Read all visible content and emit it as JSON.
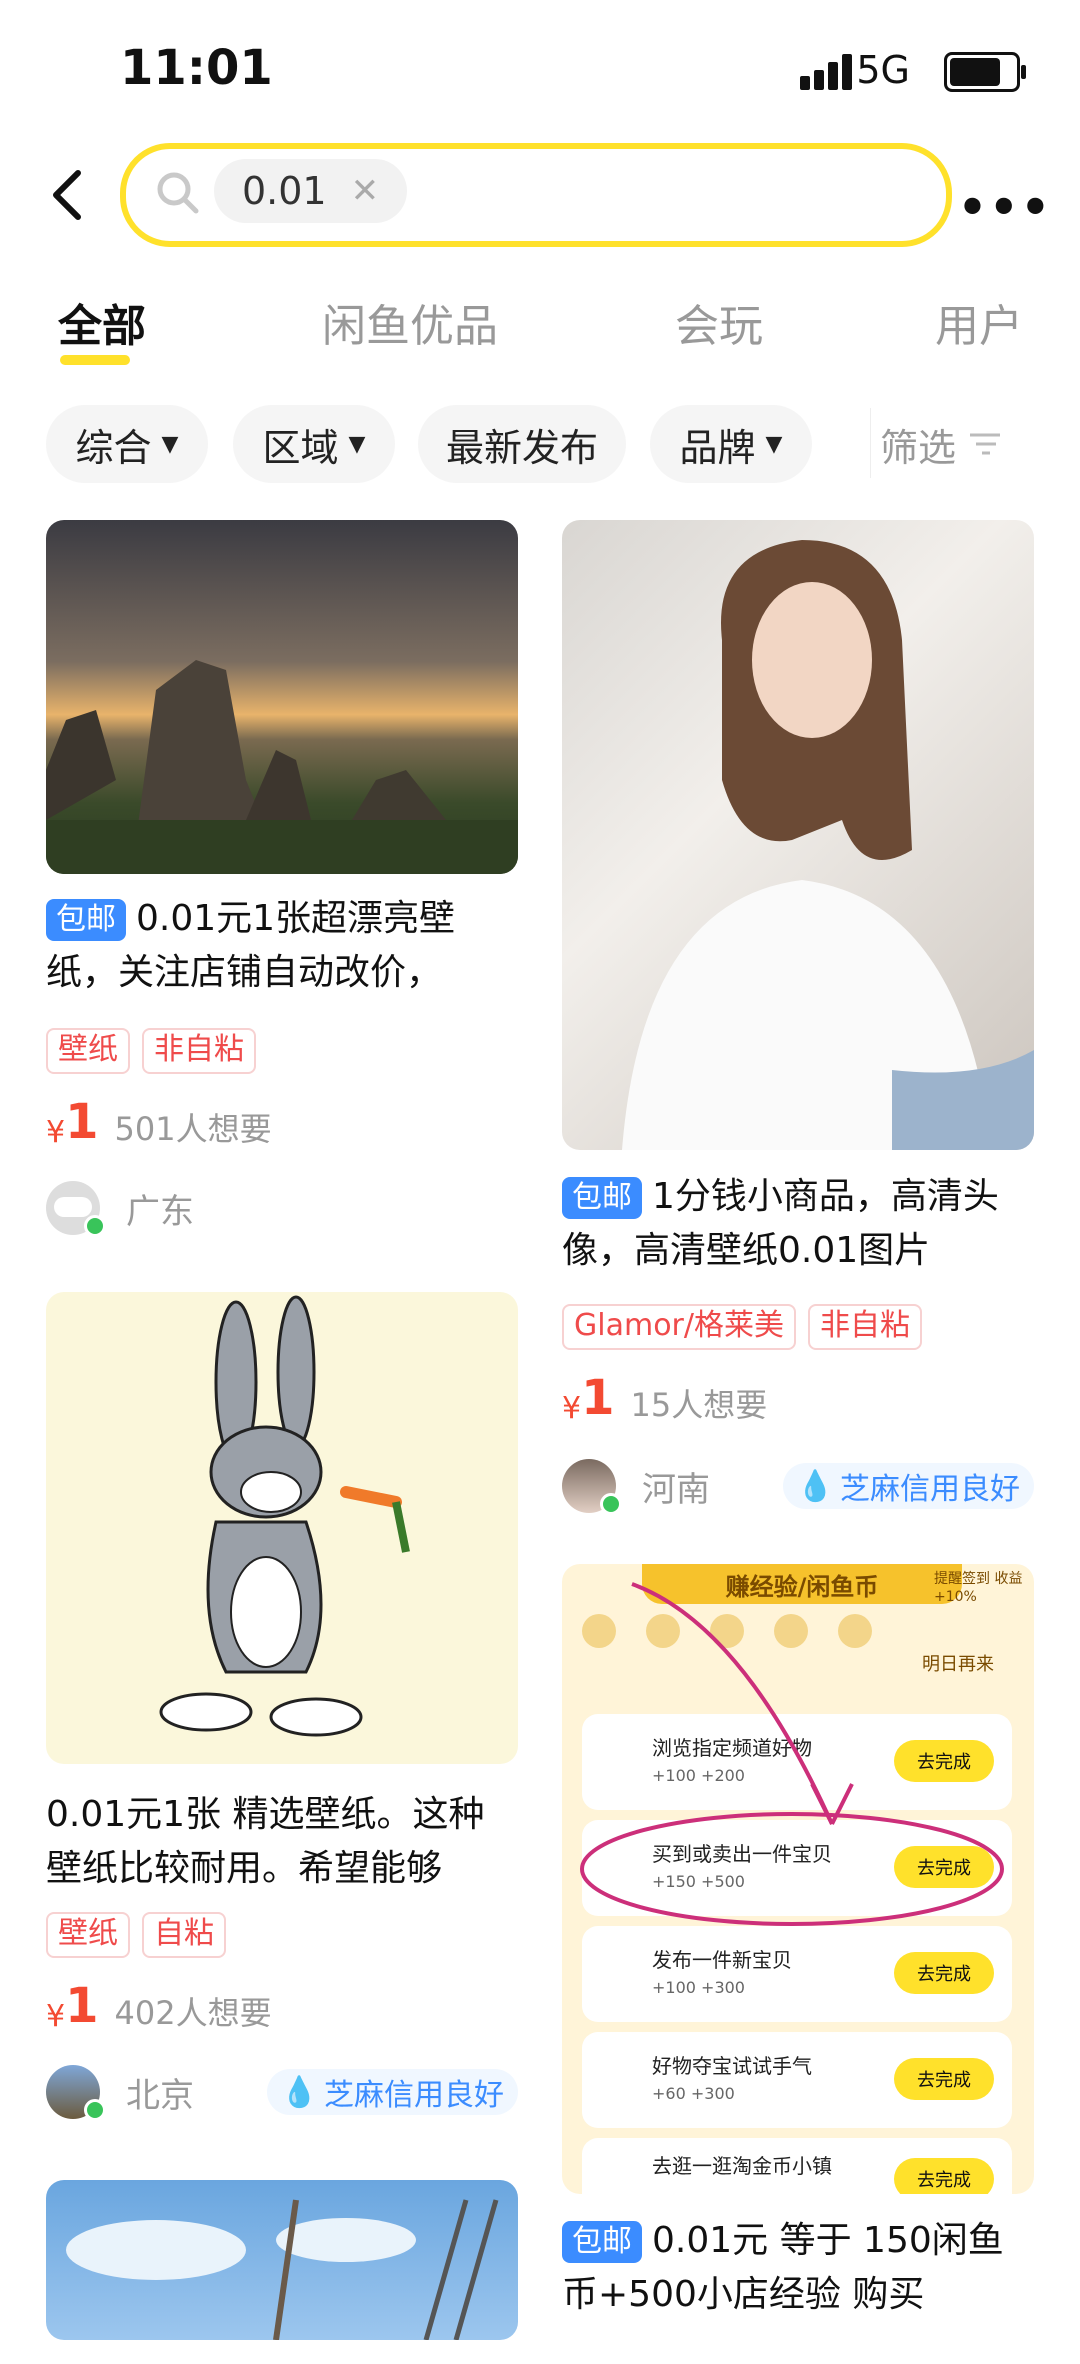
{
  "status": {
    "time": "11:01",
    "network": "5G"
  },
  "search": {
    "query": "0.01"
  },
  "tabs": [
    {
      "label": "全部"
    },
    {
      "label": "闲鱼优品"
    },
    {
      "label": "会玩"
    },
    {
      "label": "用户"
    }
  ],
  "filters": [
    {
      "label": "综合"
    },
    {
      "label": "区域"
    },
    {
      "label": "最新发布"
    },
    {
      "label": "品牌"
    }
  ],
  "screen": {
    "label": "筛选"
  },
  "products": [
    {
      "badge": "包邮",
      "title": "0.01元1张超漂亮壁纸，关注店铺自动改价，",
      "tags": [
        "壁纸",
        "非自粘"
      ],
      "price_symbol": "¥",
      "price": "1",
      "want": "501人想要",
      "region": "广东"
    },
    {
      "badge": "",
      "title": "0.01元1张 精选壁纸。这种壁纸比较耐用。希望能够",
      "tags": [
        "壁纸",
        "自粘"
      ],
      "price_symbol": "¥",
      "price": "1",
      "want": "402人想要",
      "region": "北京",
      "credit": "芝麻信用良好"
    },
    {
      "badge": "包邮",
      "title": "1分钱小商品，高清头像，高清壁纸0.01图片",
      "tags": [
        "Glamor/格莱美",
        "非自粘"
      ],
      "price_symbol": "¥",
      "price": "1",
      "want": "15人想要",
      "region": "河南",
      "credit": "芝麻信用良好"
    },
    {
      "badge": "包邮",
      "title": "0.01元 等于 150闲鱼币+500小店经验 购买",
      "image_text": {
        "banner": "赚经验/闲鱼币",
        "topright": "提醒签到 收益+10%",
        "tomorrow": "明日再来",
        "rows": [
          {
            "name": "浏览指定频道好物",
            "sub": "+100 +200",
            "btn": "去完成"
          },
          {
            "name": "买到或卖出一件宝贝",
            "sub": "+150 +500",
            "btn": "去完成"
          },
          {
            "name": "发布一件新宝贝",
            "sub": "+100 +300",
            "btn": "去完成"
          },
          {
            "name": "好物夺宝试试手气",
            "sub": "+60 +300",
            "btn": "去完成"
          },
          {
            "name": "去逛一逛淘金币小镇",
            "sub": "",
            "btn": "去完成"
          }
        ]
      }
    }
  ],
  "colors": {
    "accent": "#ffe12b",
    "price": "#f34a32",
    "badge": "#3b8cff"
  }
}
